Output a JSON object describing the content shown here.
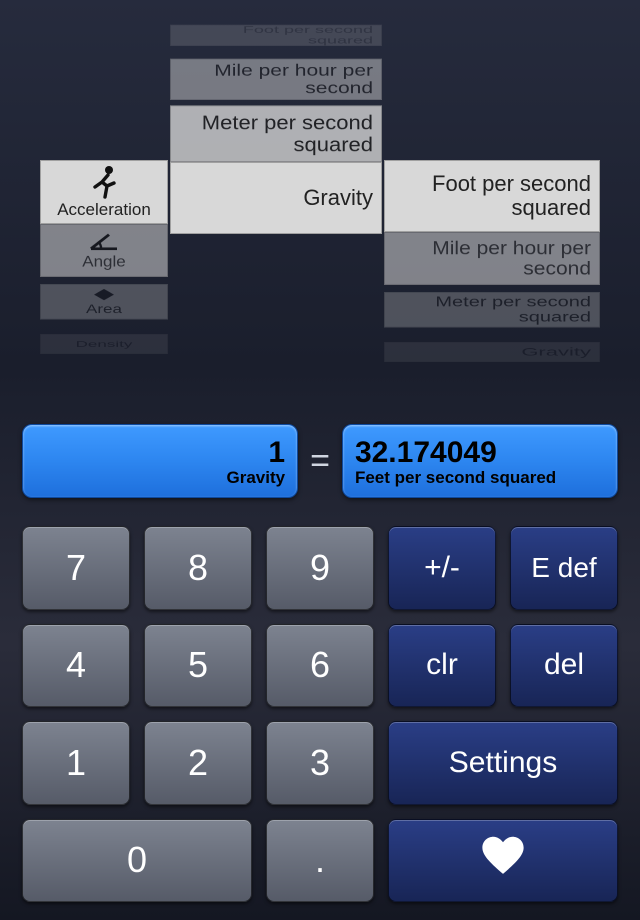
{
  "picker": {
    "category": {
      "above": [],
      "selected": {
        "label": "Acceleration",
        "icon": "runner"
      },
      "below": [
        {
          "label": "Angle",
          "icon": "angle"
        },
        {
          "label": "Area",
          "icon": "area"
        },
        {
          "label": "Density",
          "icon": "density"
        }
      ]
    },
    "from": {
      "above": [
        "Foot per second squared",
        "Mile per hour per second",
        "Meter per second squared"
      ],
      "selected": "Gravity",
      "below": []
    },
    "to": {
      "above": [],
      "selected": "Foot per second squared",
      "below": [
        "Mile per hour per second",
        "Meter per second squared",
        "Gravity"
      ]
    }
  },
  "result": {
    "input_value": "1",
    "input_unit": "Gravity",
    "equals": "=",
    "output_value": "32.174049",
    "output_unit": "Feet per second squared"
  },
  "keys": {
    "n7": "7",
    "n8": "8",
    "n9": "9",
    "pm": "+/-",
    "edef": "E def",
    "n4": "4",
    "n5": "5",
    "n6": "6",
    "clr": "clr",
    "del": "del",
    "n1": "1",
    "n2": "2",
    "n3": "3",
    "settings": "Settings",
    "n0": "0",
    "dot": ".",
    "heart": "♥"
  }
}
